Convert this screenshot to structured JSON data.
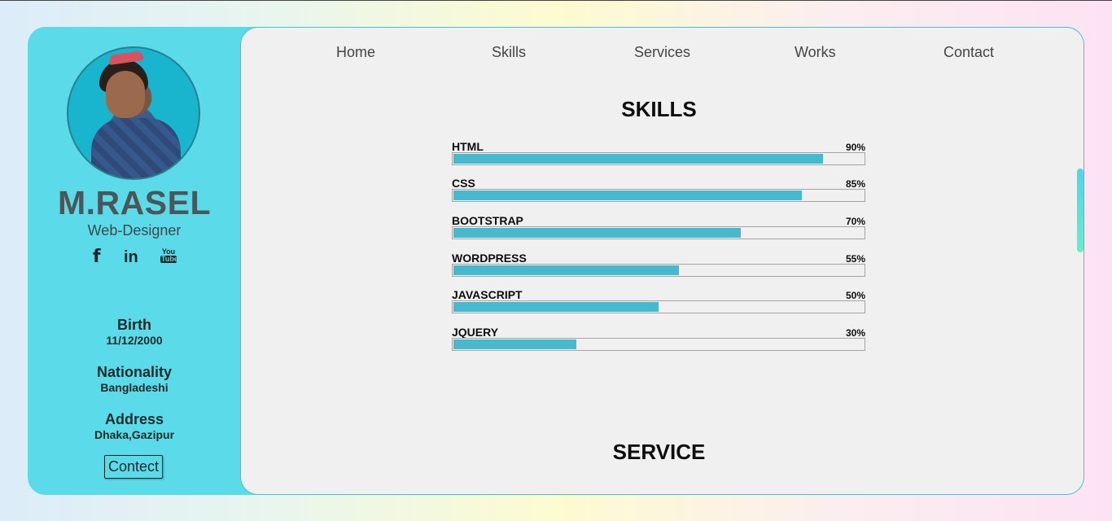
{
  "profile": {
    "name": "M.RASEL",
    "role": "Web-Designer",
    "socials": [
      {
        "icon": "facebook-icon",
        "glyph": "f"
      },
      {
        "icon": "linkedin-icon",
        "glyph": "in"
      },
      {
        "icon": "youtube-icon",
        "top": "You",
        "bottom": "Tube"
      }
    ],
    "info": [
      {
        "label": "Birth",
        "value": "11/12/2000"
      },
      {
        "label": "Nationality",
        "value": "Bangladeshi"
      },
      {
        "label": "Address",
        "value": "Dhaka,Gazipur"
      }
    ],
    "contact_button": "Contect"
  },
  "nav": [
    "Home",
    "Skills",
    "Services",
    "Works",
    "Contact"
  ],
  "skills_section": {
    "title": "SKILLS",
    "items": [
      {
        "name": "HTML",
        "percent_label": "90%",
        "percent": 90
      },
      {
        "name": "CSS",
        "percent_label": "85%",
        "percent": 85
      },
      {
        "name": "BOOTSTRAP",
        "percent_label": "70%",
        "percent": 70
      },
      {
        "name": "WORDPRESS",
        "percent_label": "55%",
        "percent": 55
      },
      {
        "name": "JAVASCRIPT",
        "percent_label": "50%",
        "percent": 50
      },
      {
        "name": "JQUERY",
        "percent_label": "30%",
        "percent": 30
      }
    ]
  },
  "service_section": {
    "title": "SERVICE"
  },
  "colors": {
    "accent": "#5bdbe9",
    "bar_fill": "#46b9cf",
    "panel": "#f0f0f0"
  }
}
